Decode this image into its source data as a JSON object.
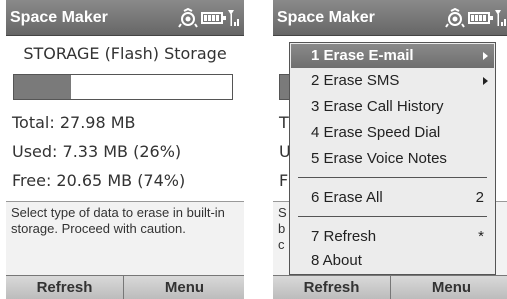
{
  "left_screen": {
    "title": "Space Maker",
    "storage_heading": "STORAGE (Flash) Storage",
    "used_fraction": 0.26,
    "total": "Total: 27.98 MB",
    "used": "Used:  7.33 MB (26%)",
    "free": "Free:  20.65 MB (74%)",
    "help_text": "Select type of data to erase in built-in storage.  Proceed with caution.",
    "softkey_left": "Refresh",
    "softkey_right": "Menu"
  },
  "right_screen": {
    "title": "Space Maker",
    "fragments": [
      "T",
      "U",
      "F",
      "S",
      "b",
      "c"
    ],
    "softkey_left": "Refresh",
    "softkey_right": "Menu",
    "menu": {
      "items": [
        {
          "label": "1 Erase E-mail",
          "submenu": true,
          "selected": true
        },
        {
          "label": "2 Erase SMS",
          "submenu": true
        },
        {
          "label": "3 Erase Call History"
        },
        {
          "label": "4 Erase Speed Dial"
        },
        {
          "label": "5 Erase Voice Notes"
        },
        {
          "label": "6 Erase All",
          "shortcut": "2"
        },
        {
          "label": "7 Refresh",
          "shortcut": "*"
        },
        {
          "label": "8 About"
        }
      ]
    }
  },
  "status_icons": [
    "sync-icon",
    "battery-icon",
    "signal-icon"
  ]
}
